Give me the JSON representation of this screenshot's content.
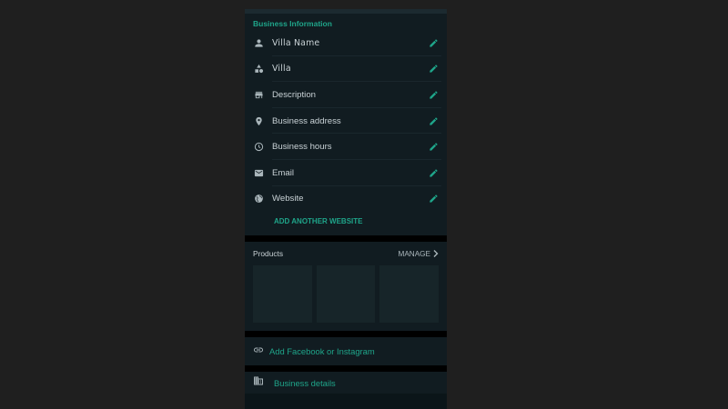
{
  "business_info": {
    "section_title": "Business Information",
    "rows": [
      {
        "label": "Villa Name",
        "icon": "person-icon"
      },
      {
        "label": "Villa",
        "icon": "category-icon"
      },
      {
        "label": "Description",
        "icon": "store-icon"
      },
      {
        "label": "Business address",
        "icon": "location-pin-icon"
      },
      {
        "label": "Business hours",
        "icon": "clock-icon"
      },
      {
        "label": "Email",
        "icon": "mail-icon"
      },
      {
        "label": "Website",
        "icon": "globe-icon"
      }
    ],
    "add_website_label": "ADD ANOTHER WEBSITE"
  },
  "products": {
    "title": "Products",
    "manage_label": "MANAGE"
  },
  "social": {
    "label": "Add Facebook or Instagram"
  },
  "details": {
    "label": "Business details"
  },
  "colors": {
    "accent": "#1fa58a",
    "background": "#111c21",
    "text": "#c9d2d6"
  }
}
